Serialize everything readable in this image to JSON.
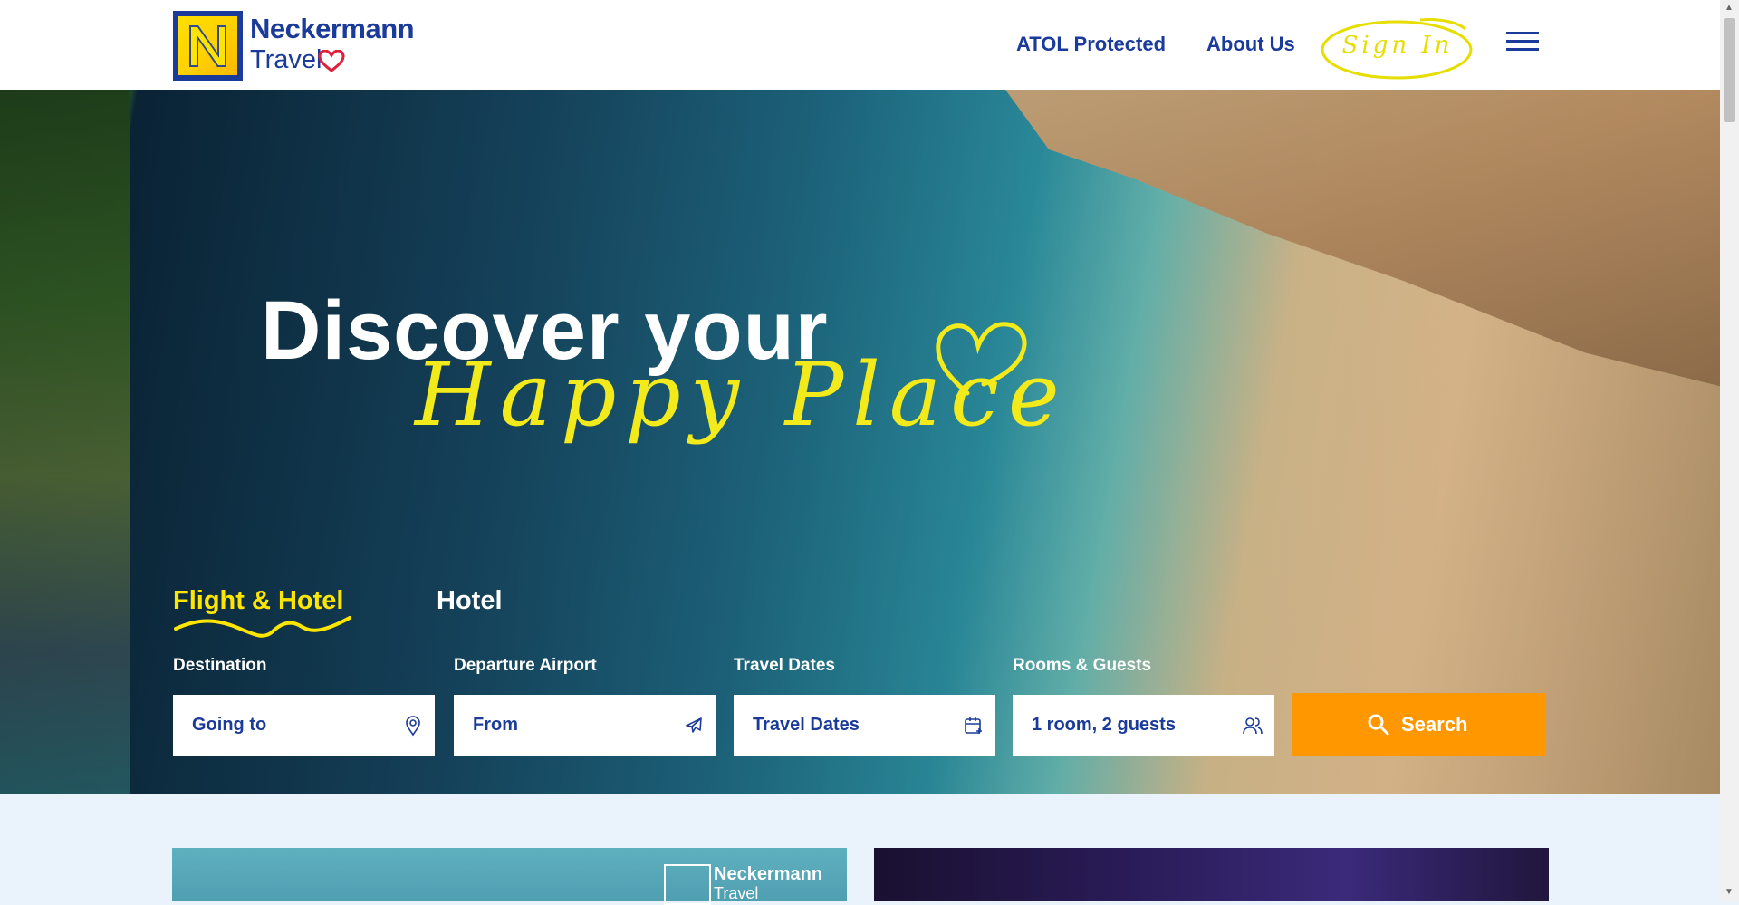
{
  "header": {
    "logo_word1": "Neckermann",
    "logo_word2": "Travel",
    "nav": {
      "atol": "ATOL Protected",
      "about": "About Us",
      "sign_in": "Sign In"
    }
  },
  "hero": {
    "headline": "Discover your",
    "script": "Happy Place",
    "tabs": [
      "Flight & Hotel",
      "Hotel"
    ],
    "active_tab": "Flight & Hotel",
    "fields": [
      {
        "label": "Destination",
        "placeholder": "Going to",
        "icon": "map-pin-icon"
      },
      {
        "label": "Departure Airport",
        "placeholder": "From",
        "icon": "plane-icon"
      },
      {
        "label": "Travel Dates",
        "placeholder": "Travel Dates",
        "icon": "calendar-icon"
      },
      {
        "label": "Rooms & Guests",
        "value": "1 room, 2 guests",
        "icon": "guests-icon"
      }
    ],
    "search_label": "Search"
  },
  "promo": {
    "card_logo_word1": "Neckermann",
    "card_logo_word2": "Travel"
  },
  "colors": {
    "brand_blue": "#1b3b9a",
    "brand_yellow": "#ffe600",
    "search_orange": "#ff9700",
    "page_bg": "#eaf3fb"
  }
}
